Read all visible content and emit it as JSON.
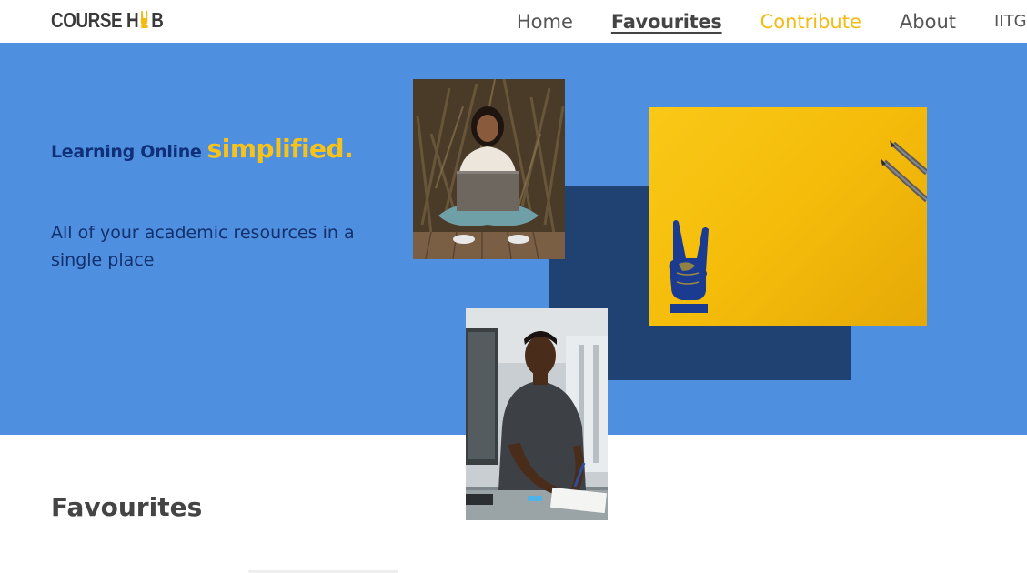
{
  "brand": {
    "logo_prefix": "COURSE H",
    "logo_suffix": "B",
    "logo_icon": "rock-hand-icon",
    "colors": {
      "hero_blue": "#4f8fdf",
      "navy": "#1f4272",
      "yellow": "#f7c31a",
      "text_dark": "#0f2f78"
    }
  },
  "nav": {
    "items": [
      {
        "label": "Home"
      },
      {
        "label": "Favourites",
        "active": true
      },
      {
        "label": "Contribute",
        "highlight": true
      },
      {
        "label": "About"
      },
      {
        "label": "IITG"
      }
    ]
  },
  "hero": {
    "tagline_part1": "Learning Online",
    "tagline_part2": "simplified.",
    "subtitle": "All of your academic resources in a single place",
    "images": [
      {
        "name": "student-laptop-photo",
        "icon": "photo"
      },
      {
        "name": "rock-hand-card",
        "icon": "rock-hand-icon"
      },
      {
        "name": "student-writing-photo",
        "icon": "photo"
      }
    ]
  },
  "favourites": {
    "title": "Favourites"
  }
}
